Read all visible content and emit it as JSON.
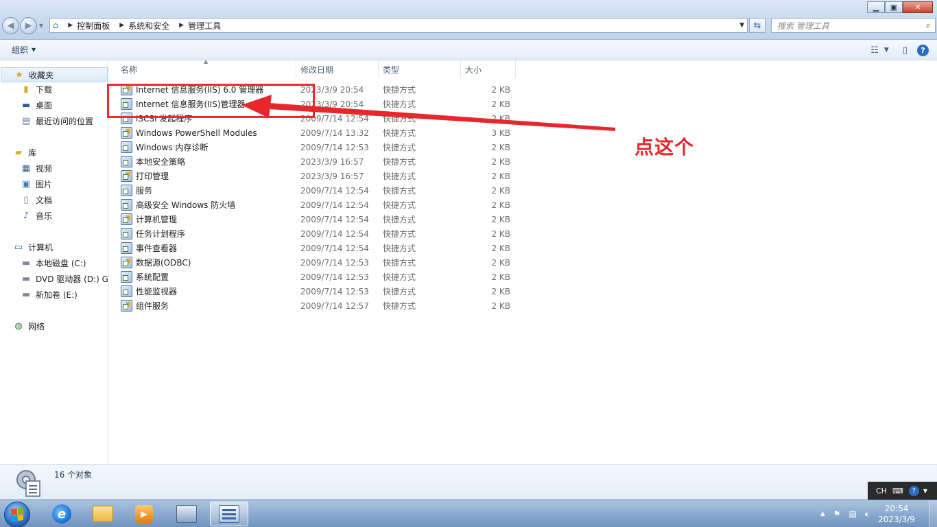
{
  "window": {
    "minimize": "▁",
    "maximize": "▣",
    "close": "✕"
  },
  "address": {
    "breadcrumbs": [
      "控制面板",
      "系统和安全",
      "管理工具"
    ]
  },
  "search": {
    "placeholder": "搜索 管理工具"
  },
  "toolbar": {
    "organize_label": "组织"
  },
  "nav": {
    "favorites": {
      "label": "收藏夹",
      "items": [
        "下载",
        "桌面",
        "最近访问的位置"
      ]
    },
    "libraries": {
      "label": "库",
      "items": [
        "视频",
        "图片",
        "文档",
        "音乐"
      ]
    },
    "computer": {
      "label": "计算机",
      "items": [
        "本地磁盘 (C:)",
        "DVD 驱动器 (D:) GR",
        "新加卷 (E:)"
      ]
    },
    "network": {
      "label": "网络"
    }
  },
  "columns": {
    "name": "名称",
    "date": "修改日期",
    "type": "类型",
    "size": "大小"
  },
  "files": [
    {
      "name": "Internet 信息服务(IIS) 6.0 管理器",
      "date": "2023/3/9 20:54",
      "type": "快捷方式",
      "size": "2 KB"
    },
    {
      "name": "Internet 信息服务(IIS)管理器",
      "date": "2023/3/9 20:54",
      "type": "快捷方式",
      "size": "2 KB"
    },
    {
      "name": "iSCSI 发起程序",
      "date": "2009/7/14 12:54",
      "type": "快捷方式",
      "size": "2 KB"
    },
    {
      "name": "Windows PowerShell Modules",
      "date": "2009/7/14 13:32",
      "type": "快捷方式",
      "size": "3 KB"
    },
    {
      "name": "Windows 内存诊断",
      "date": "2009/7/14 12:53",
      "type": "快捷方式",
      "size": "2 KB"
    },
    {
      "name": "本地安全策略",
      "date": "2023/3/9 16:57",
      "type": "快捷方式",
      "size": "2 KB"
    },
    {
      "name": "打印管理",
      "date": "2023/3/9 16:57",
      "type": "快捷方式",
      "size": "2 KB"
    },
    {
      "name": "服务",
      "date": "2009/7/14 12:54",
      "type": "快捷方式",
      "size": "2 KB"
    },
    {
      "name": "高级安全 Windows 防火墙",
      "date": "2009/7/14 12:54",
      "type": "快捷方式",
      "size": "2 KB"
    },
    {
      "name": "计算机管理",
      "date": "2009/7/14 12:54",
      "type": "快捷方式",
      "size": "2 KB"
    },
    {
      "name": "任务计划程序",
      "date": "2009/7/14 12:54",
      "type": "快捷方式",
      "size": "2 KB"
    },
    {
      "name": "事件查看器",
      "date": "2009/7/14 12:54",
      "type": "快捷方式",
      "size": "2 KB"
    },
    {
      "name": "数据源(ODBC)",
      "date": "2009/7/14 12:53",
      "type": "快捷方式",
      "size": "2 KB"
    },
    {
      "name": "系统配置",
      "date": "2009/7/14 12:53",
      "type": "快捷方式",
      "size": "2 KB"
    },
    {
      "name": "性能监视器",
      "date": "2009/7/14 12:53",
      "type": "快捷方式",
      "size": "2 KB"
    },
    {
      "name": "组件服务",
      "date": "2009/7/14 12:57",
      "type": "快捷方式",
      "size": "2 KB"
    }
  ],
  "annotation": {
    "text": "点这个",
    "color": "#e7272c"
  },
  "status": {
    "count": "16 个对象"
  },
  "langbar": {
    "lang": "CH"
  },
  "clock": {
    "time": "20:54",
    "date": "2023/3/9"
  },
  "colors": {
    "accent": "#2a6cc3",
    "annotation_red": "#ee2a2f"
  }
}
